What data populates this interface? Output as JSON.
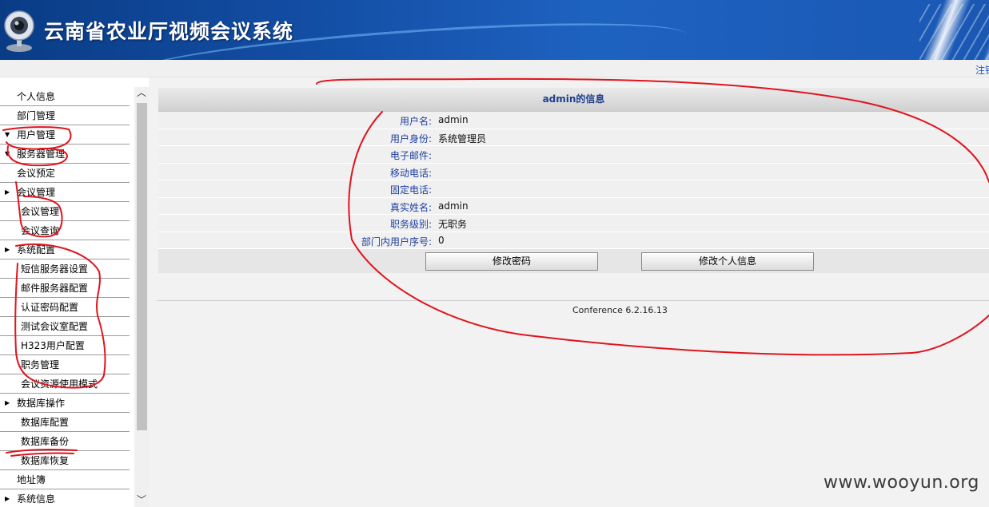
{
  "header": {
    "title": "云南省农业厅视频会议系统",
    "logout_link": "注销"
  },
  "sidebar": {
    "items": [
      {
        "label": "个人信息",
        "level": 1,
        "arrow": ""
      },
      {
        "label": "部门管理",
        "level": 1,
        "arrow": ""
      },
      {
        "label": "用户管理",
        "level": 1,
        "arrow": "▼"
      },
      {
        "label": "服务器管理",
        "level": 1,
        "arrow": "▼"
      },
      {
        "label": "会议预定",
        "level": 1,
        "arrow": ""
      },
      {
        "label": "会议管理",
        "level": 1,
        "arrow": "▶"
      },
      {
        "label": "会议管理",
        "level": 2,
        "arrow": ""
      },
      {
        "label": "会议查询",
        "level": 2,
        "arrow": ""
      },
      {
        "label": "系统配置",
        "level": 1,
        "arrow": "▶"
      },
      {
        "label": "短信服务器设置",
        "level": 2,
        "arrow": ""
      },
      {
        "label": "邮件服务器配置",
        "level": 2,
        "arrow": ""
      },
      {
        "label": "认证密码配置",
        "level": 2,
        "arrow": ""
      },
      {
        "label": "测试会议室配置",
        "level": 2,
        "arrow": ""
      },
      {
        "label": "H323用户配置",
        "level": 2,
        "arrow": ""
      },
      {
        "label": "职务管理",
        "level": 2,
        "arrow": ""
      },
      {
        "label": "会议资源使用模式",
        "level": 2,
        "arrow": ""
      },
      {
        "label": "数据库操作",
        "level": 1,
        "arrow": "▶"
      },
      {
        "label": "数据库配置",
        "level": 2,
        "arrow": ""
      },
      {
        "label": "数据库备份",
        "level": 2,
        "arrow": ""
      },
      {
        "label": "数据库恢复",
        "level": 2,
        "arrow": ""
      },
      {
        "label": "地址簿",
        "level": 1,
        "arrow": ""
      },
      {
        "label": "系统信息",
        "level": 1,
        "arrow": "▶"
      }
    ]
  },
  "info": {
    "heading": "admin的信息",
    "rows": [
      {
        "label": "用户名:",
        "value": "admin"
      },
      {
        "label": "用户身份:",
        "value": "系统管理员"
      },
      {
        "label": "电子邮件:",
        "value": ""
      },
      {
        "label": "移动电话:",
        "value": ""
      },
      {
        "label": "固定电话:",
        "value": ""
      },
      {
        "label": "真实姓名:",
        "value": "admin"
      },
      {
        "label": "职务级别:",
        "value": "无职务"
      },
      {
        "label": "部门内用户序号:",
        "value": "0"
      }
    ],
    "change_password_label": "修改密码",
    "edit_profile_label": "修改个人信息"
  },
  "footer": {
    "version": "Conference 6.2.16.13"
  },
  "watermark": "www.wooyun.org",
  "colors": {
    "header_blue": "#1450a8",
    "label_blue": "#1f3fa0",
    "annotation_red": "#e0141e"
  }
}
